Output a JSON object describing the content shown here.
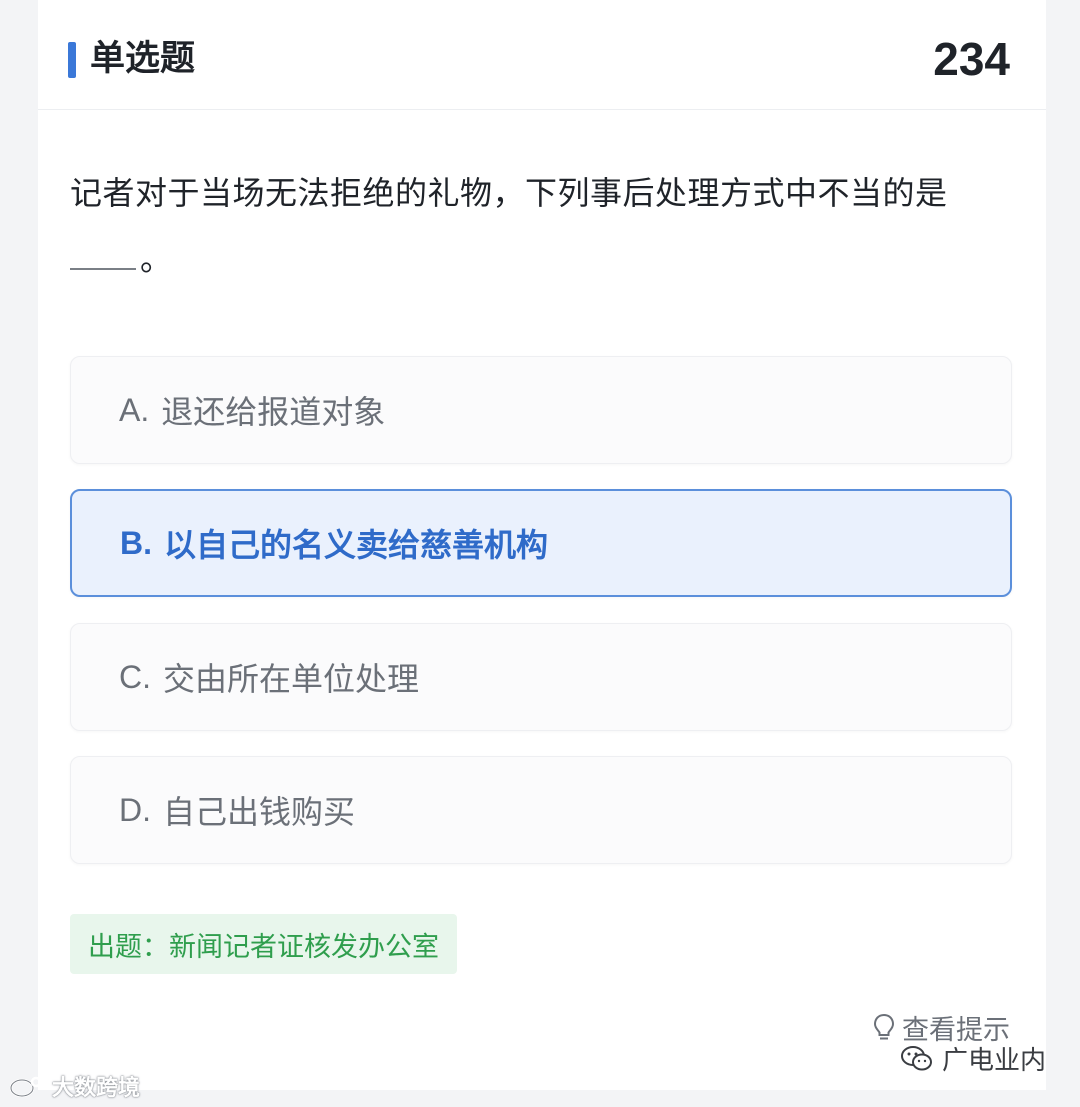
{
  "header": {
    "question_type": "单选题",
    "question_number": "234"
  },
  "question": {
    "text": "记者对于当场无法拒绝的礼物，下列事后处理方式中不当的是",
    "tail": "。"
  },
  "options": [
    {
      "letter": "A.",
      "text": "退还给报道对象",
      "selected": false
    },
    {
      "letter": "B.",
      "text": "以自己的名义卖给慈善机构",
      "selected": true
    },
    {
      "letter": "C.",
      "text": "交由所在单位处理",
      "selected": false
    },
    {
      "letter": "D.",
      "text": "自己出钱购买",
      "selected": false
    }
  ],
  "source": "出题：新闻记者证核发办公室",
  "hint_label": "查看提示",
  "watermarks": {
    "right": "广电业内",
    "left": "大数跨境"
  },
  "colors": {
    "accent": "#3b78d8",
    "selected_bg": "#eaf1fd",
    "selected_text": "#2f6bc9",
    "source_bg": "#e8f6ec",
    "source_text": "#2f9e4d"
  },
  "icons": {
    "hint": "lightbulb-icon",
    "wechat": "wechat-icon",
    "weibo": "weibo-icon"
  }
}
